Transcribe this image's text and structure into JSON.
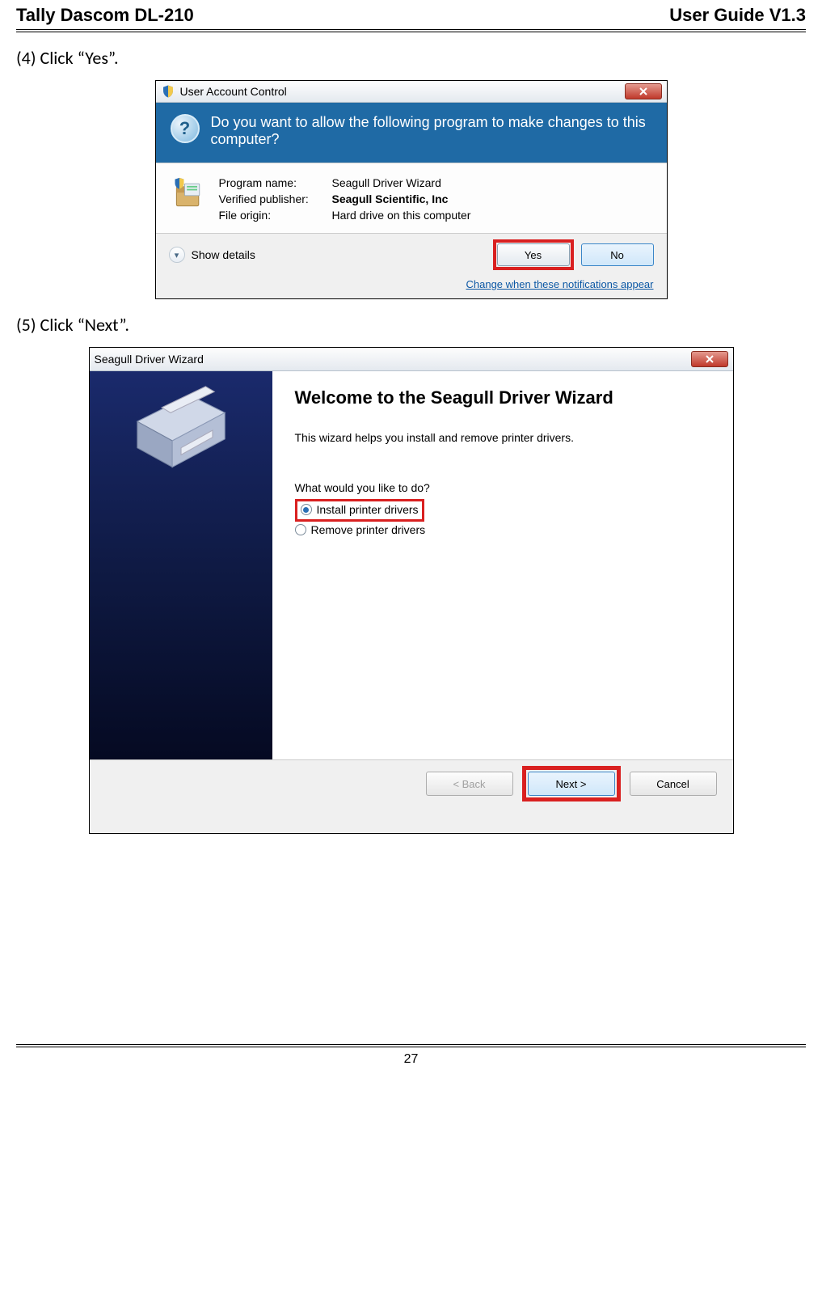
{
  "header": {
    "left": "Tally Dascom DL-210",
    "right": "User Guide V1.3"
  },
  "steps": {
    "s4": "(4) Click “Yes”.",
    "s5": "(5) Click “Next”."
  },
  "uac": {
    "title": "User Account Control",
    "question": "Do you want to allow the following program to make changes to this computer?",
    "labels": {
      "program": "Program name:",
      "publisher": "Verified publisher:",
      "origin": "File origin:"
    },
    "values": {
      "program": "Seagull Driver Wizard",
      "publisher": "Seagull Scientific, Inc",
      "origin": "Hard drive on this computer"
    },
    "showDetails": "Show details",
    "yes": "Yes",
    "no": "No",
    "link": "Change when these notifications appear"
  },
  "wizard": {
    "title": "Seagull Driver Wizard",
    "heading": "Welcome to the Seagull Driver Wizard",
    "desc": "This wizard helps you install and remove printer drivers.",
    "question": "What would you like to do?",
    "optInstall": "Install printer drivers",
    "optRemove": "Remove printer drivers",
    "back": "< Back",
    "next": "Next >",
    "cancel": "Cancel"
  },
  "footer": {
    "page": "27"
  }
}
